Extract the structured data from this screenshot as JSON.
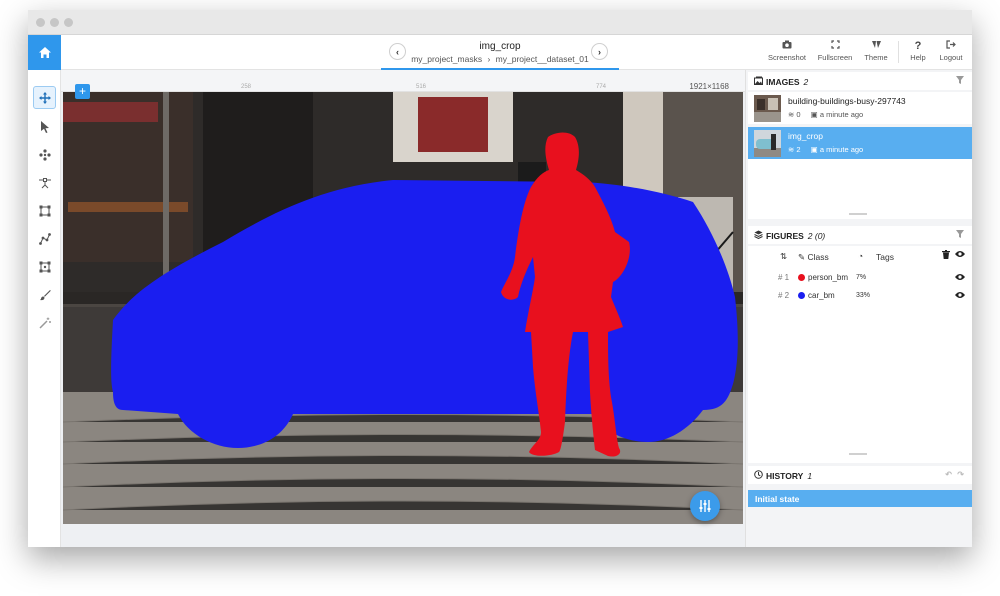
{
  "topbar": {
    "image_title": "img_crop",
    "breadcrumb": {
      "project": "my_project_masks",
      "separator": "›",
      "dataset": "my_project__dataset_01"
    },
    "tools": [
      {
        "label": "Screenshot",
        "icon": "camera-icon"
      },
      {
        "label": "Fullscreen",
        "icon": "fullscreen-icon"
      },
      {
        "label": "Theme",
        "icon": "theme-icon"
      },
      {
        "label": "Help",
        "icon": "help-icon"
      },
      {
        "label": "Logout",
        "icon": "logout-icon"
      }
    ]
  },
  "toolbar": {
    "tools": [
      "move-tool",
      "select-tool",
      "points-tool",
      "bitmap-tool",
      "rectangle-tool",
      "polyline-tool",
      "polygon-tool",
      "brush-tool",
      "magic-wand-tool"
    ]
  },
  "canvas": {
    "dimensions": "1921×1168",
    "ruler_ticks": [
      "258",
      "516",
      "774"
    ],
    "add_label": "+"
  },
  "images_panel": {
    "title": "IMAGES",
    "count": "2",
    "items": [
      {
        "name": "building-buildings-busy-297743",
        "figures": "0",
        "time": "a minute ago",
        "selected": false
      },
      {
        "name": "img_crop",
        "figures": "2",
        "time": "a minute ago",
        "selected": true
      }
    ]
  },
  "figures_panel": {
    "title": "FIGURES",
    "count": "2 (0)",
    "columns": {
      "class": "Class",
      "tags": "Tags"
    },
    "rows": [
      {
        "index": "# 1",
        "class": "person_bm",
        "color": "#e8101e",
        "percent": "7%"
      },
      {
        "index": "# 2",
        "class": "car_bm",
        "color": "#1a1ef0",
        "percent": "33%"
      }
    ]
  },
  "history_panel": {
    "title": "HISTORY",
    "count": "1",
    "entries": [
      "Initial state"
    ]
  },
  "colors": {
    "accent": "#2f97ec",
    "person_mask": "#e8101e",
    "car_mask": "#1a1ef0"
  }
}
